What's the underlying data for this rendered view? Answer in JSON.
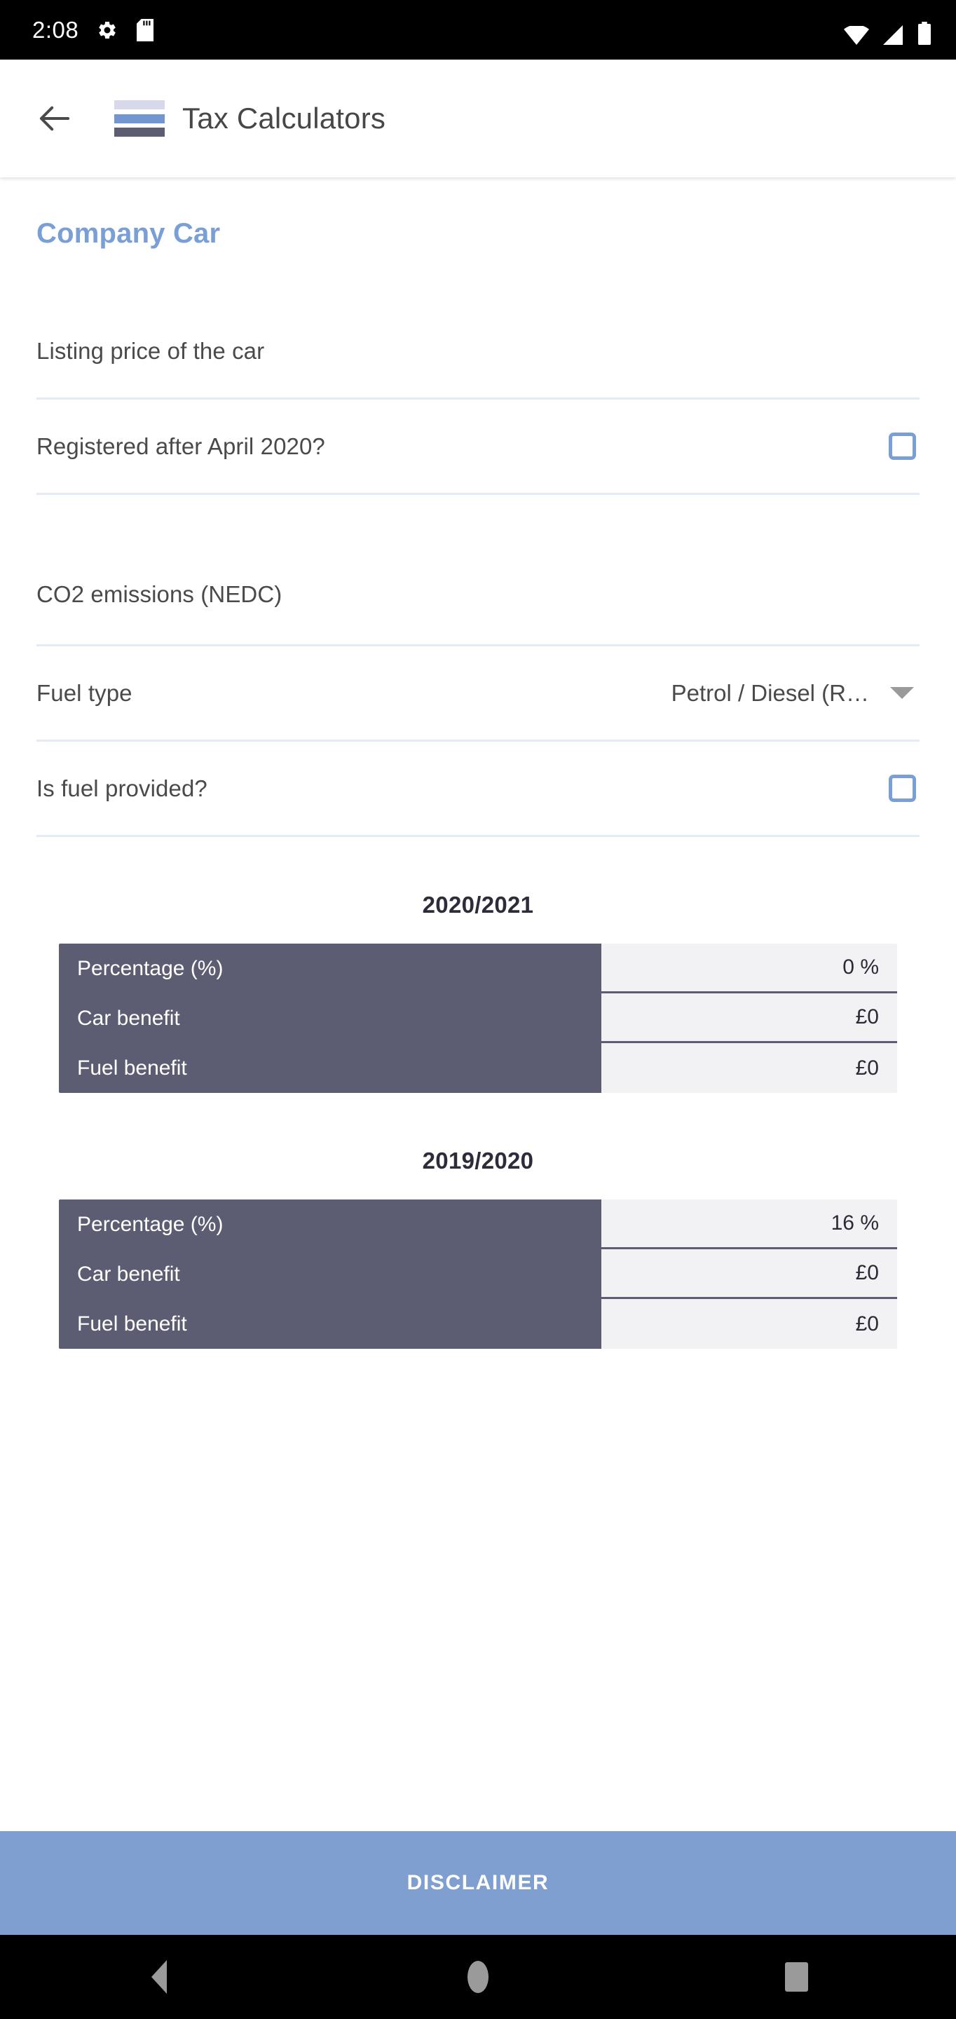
{
  "status_bar": {
    "clock": "2:08",
    "left_icons": [
      "settings-gear-icon",
      "sd-card-icon"
    ],
    "right_icons": [
      "wifi-icon",
      "cell-signal-icon",
      "battery-icon"
    ]
  },
  "app_bar": {
    "back_icon": "arrow-back-icon",
    "logo_icon": "tax-calculators-logo",
    "title": "Tax Calculators",
    "logo_colors": [
      "#d7d9ea",
      "#7297d0",
      "#5c5c72"
    ]
  },
  "page": {
    "section_title": "Company Car",
    "accent_color": "#7a9ed6",
    "divider_color": "#e4eaf3"
  },
  "form": {
    "fields": [
      {
        "label": "Listing price of the car",
        "type": "text",
        "value": "",
        "placeholder": ""
      },
      {
        "label": "Registered after April 2020?",
        "type": "checkbox",
        "checked": false
      },
      {
        "label": "CO2 emissions (NEDC)",
        "type": "text",
        "value": "",
        "placeholder": ""
      },
      {
        "label": "Fuel type",
        "type": "select",
        "value": "Petrol / Diesel (R…",
        "caret_icon": "chevron-down-icon"
      },
      {
        "label": "Is fuel provided?",
        "type": "checkbox",
        "checked": false
      }
    ]
  },
  "results": [
    {
      "title": "2020/2021",
      "rows": [
        {
          "label": "Percentage (%)",
          "value": "0 %"
        },
        {
          "label": "Car benefit",
          "value": "£0"
        },
        {
          "label": "Fuel benefit",
          "value": "£0"
        }
      ]
    },
    {
      "title": "2019/2020",
      "rows": [
        {
          "label": "Percentage (%)",
          "value": "16 %"
        },
        {
          "label": "Car benefit",
          "value": "£0"
        },
        {
          "label": "Fuel benefit",
          "value": "£0"
        }
      ]
    }
  ],
  "footer": {
    "disclaimer_label": "DISCLAIMER",
    "disclaimer_color": "#7f9fd0"
  },
  "nav_bar": {
    "back_icon": "nav-back-triangle-icon",
    "home_icon": "nav-home-circle-icon",
    "recents_icon": "nav-recents-square-icon"
  }
}
